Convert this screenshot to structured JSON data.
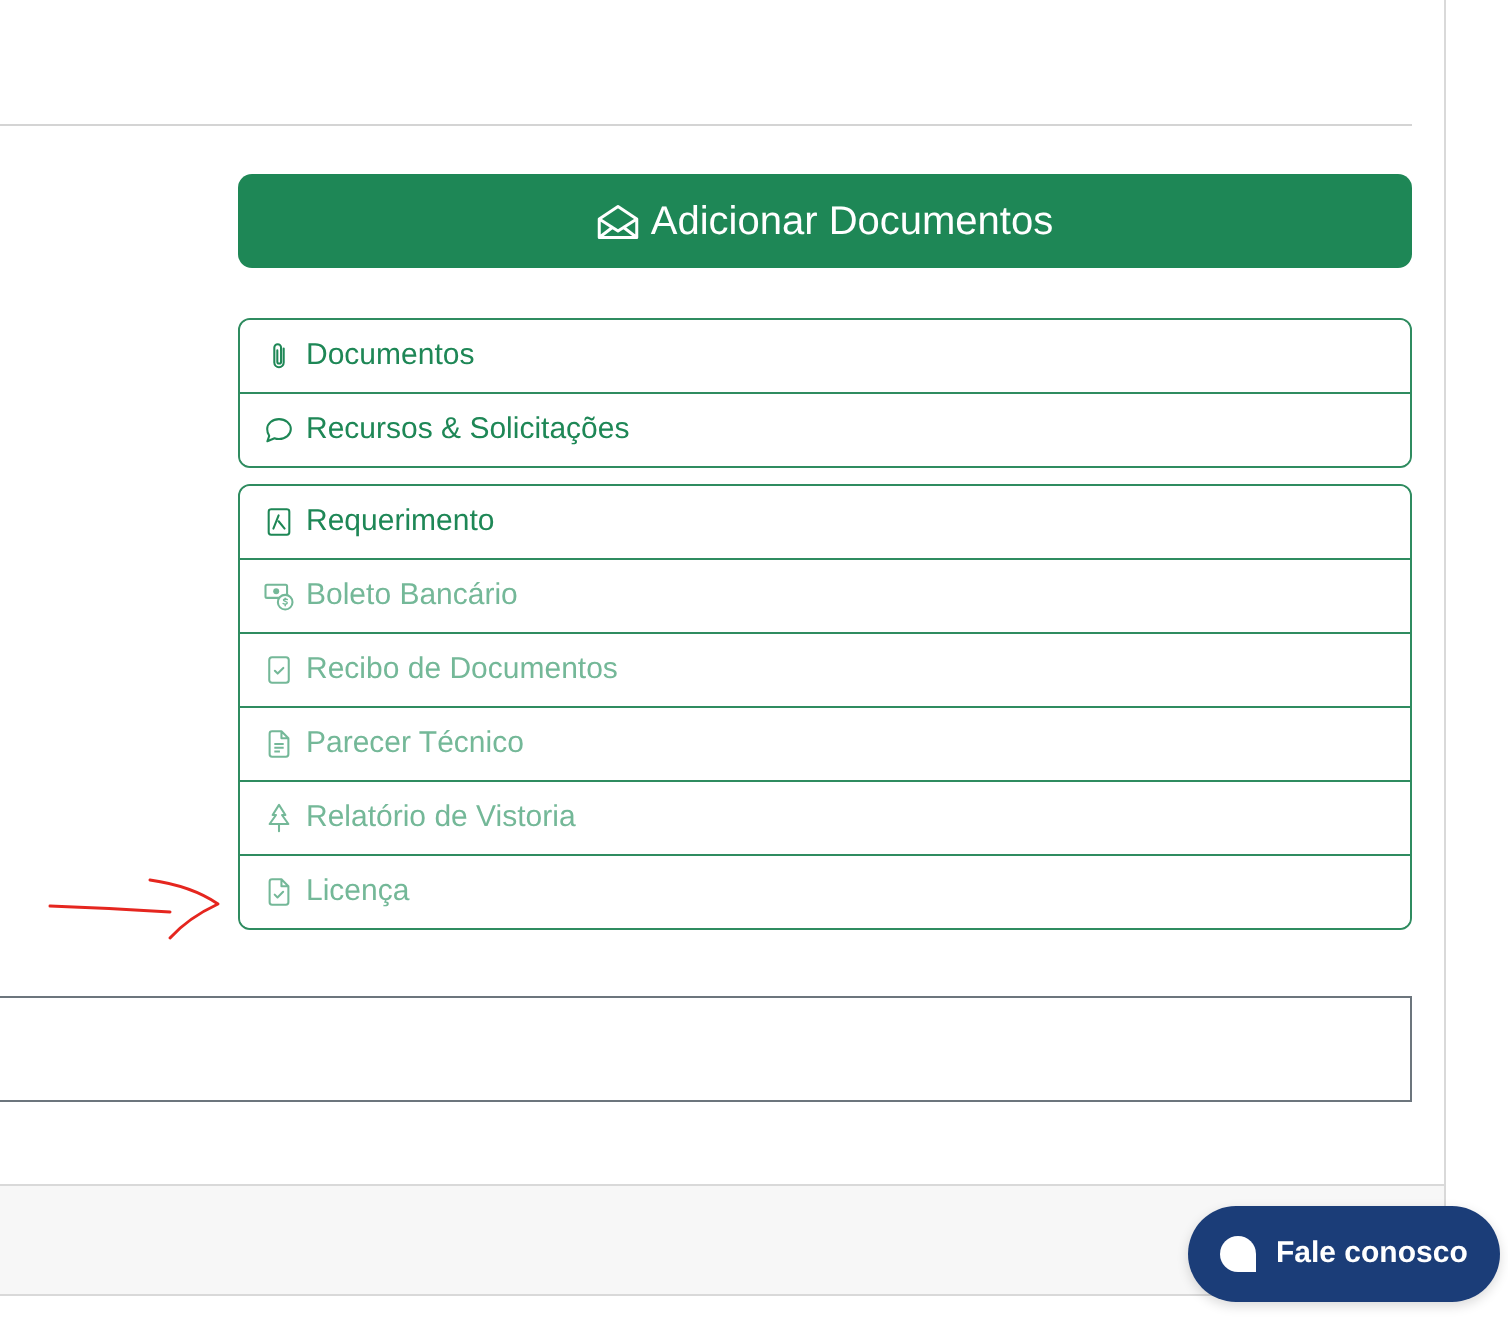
{
  "add_button": {
    "label": "Adicionar Documentos"
  },
  "menu_groups": [
    {
      "items": [
        {
          "kind": "attachments",
          "label": "Documentos",
          "disabled": false
        },
        {
          "kind": "messages",
          "label": "Recursos & Solicitações",
          "disabled": false
        }
      ]
    },
    {
      "items": [
        {
          "kind": "form",
          "label": "Requerimento",
          "disabled": false
        },
        {
          "kind": "payment",
          "label": "Boleto Bancário",
          "disabled": true
        },
        {
          "kind": "receipt",
          "label": "Recibo de Documentos",
          "disabled": true
        },
        {
          "kind": "report",
          "label": "Parecer Técnico",
          "disabled": true
        },
        {
          "kind": "inspection",
          "label": "Relatório de Vistoria",
          "disabled": true
        },
        {
          "kind": "license",
          "label": "Licença",
          "disabled": true
        }
      ]
    }
  ],
  "chat_button": {
    "label": "Fale conosco"
  }
}
